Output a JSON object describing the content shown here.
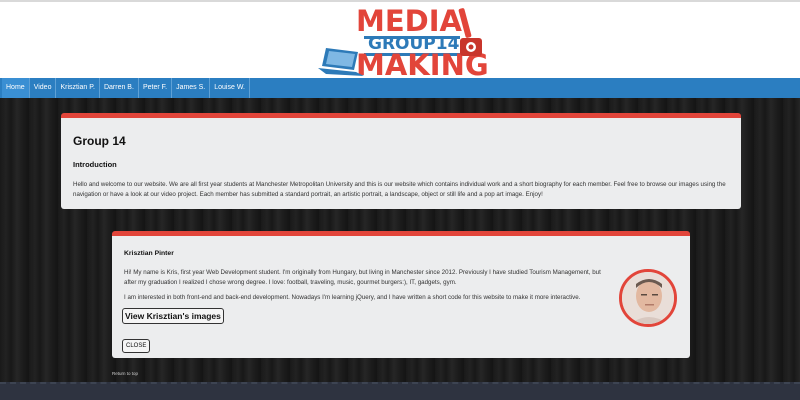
{
  "logo": {
    "top": "MEDIA",
    "middle": "GROUP14",
    "bottom": "MAKING"
  },
  "nav": {
    "items": [
      {
        "label": "Home"
      },
      {
        "label": "Video"
      },
      {
        "label": "Krisztian P."
      },
      {
        "label": "Darren B."
      },
      {
        "label": "Peter F."
      },
      {
        "label": "James S."
      },
      {
        "label": "Louise W."
      }
    ]
  },
  "intro": {
    "title": "Group 14",
    "subtitle": "Introduction",
    "body": "Hello and welcome to our website. We are all first year students at Manchester Metropolitan University and this is our website which contains individual work and a short biography for each member. Feel free to browse our images using the navigation or have a look at our video project. Each member has submitted a standard portrait, an artistic portrait, a landscape, object or still life and a pop art image. Enjoy!"
  },
  "member": {
    "name": "Krisztian Pinter",
    "bio1": "Hi! My name is Kris, first year Web Development student. I'm originally from Hungary, but living in Manchester since 2012. Previously I have studied Tourism Management, but after my graduation I realized I chose wrong degree. I love: football, traveling, music, gourmet burgers:), IT, gadgets, gym.",
    "bio2": "I am interested in both front-end and back-end development. Nowadays I'm learning jQuery, and I have written a short code for this website to make it more interactive.",
    "view_button": "View Krisztian's images",
    "close_button": "CLOSE"
  },
  "footer": {
    "return_top": "Return to top"
  },
  "colors": {
    "accent": "#e2453a",
    "nav_blue": "#2b7ec1",
    "card_bg": "#ecedee"
  }
}
